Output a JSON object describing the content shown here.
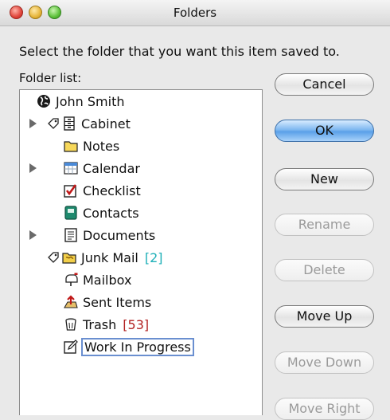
{
  "window": {
    "title": "Folders"
  },
  "prompt": "Select the folder that you want this item saved to.",
  "folder_list_label": "Folder list:",
  "folders": [
    {
      "label": "John Smith",
      "icon": "globe-icon"
    },
    {
      "label": "Cabinet",
      "icon": "cabinet-icon"
    },
    {
      "label": "Notes",
      "icon": "folder-icon"
    },
    {
      "label": "Calendar",
      "icon": "calendar-icon"
    },
    {
      "label": "Checklist",
      "icon": "checklist-icon"
    },
    {
      "label": "Contacts",
      "icon": "contacts-icon"
    },
    {
      "label": "Documents",
      "icon": "documents-icon"
    },
    {
      "label": "Junk Mail",
      "icon": "junk-folder-icon",
      "badge": "[2]"
    },
    {
      "label": "Mailbox",
      "icon": "mailbox-icon"
    },
    {
      "label": "Sent Items",
      "icon": "sent-items-icon"
    },
    {
      "label": "Trash",
      "icon": "trash-icon",
      "badge": "[53]"
    },
    {
      "label": "Work In Progress",
      "icon": "work-in-progress-icon",
      "selected": true
    }
  ],
  "buttons": {
    "cancel": "Cancel",
    "ok": "OK",
    "new": "New",
    "rename": "Rename",
    "delete": "Delete",
    "move_up": "Move Up",
    "move_down": "Move Down",
    "move_right": "Move Right"
  },
  "colors": {
    "badge_cyan": "#1fb0b8",
    "badge_red": "#b22222",
    "default_button": "#5aa0e8"
  }
}
